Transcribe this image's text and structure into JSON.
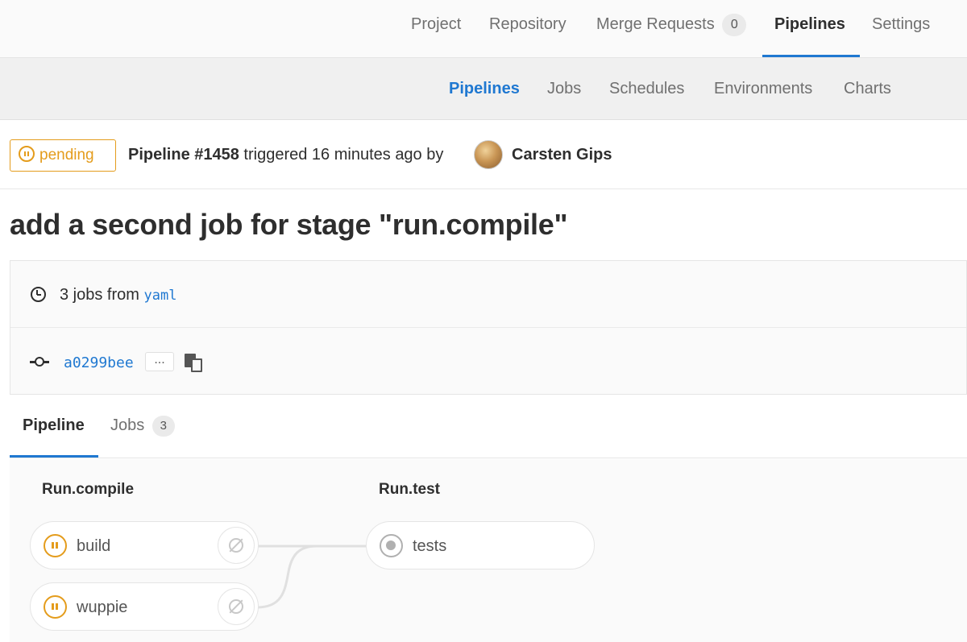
{
  "top_nav": {
    "items": [
      {
        "label": "Project"
      },
      {
        "label": "Repository"
      },
      {
        "label": "Merge Requests",
        "count": "0"
      },
      {
        "label": "Pipelines"
      },
      {
        "label": "Settings"
      }
    ],
    "active": "Pipelines"
  },
  "sub_nav": {
    "items": [
      {
        "label": "Pipelines"
      },
      {
        "label": "Jobs"
      },
      {
        "label": "Schedules"
      },
      {
        "label": "Environments"
      },
      {
        "label": "Charts"
      }
    ],
    "active": "Pipelines"
  },
  "pipeline_header": {
    "status": "pending",
    "pipeline_id": "Pipeline #1458",
    "triggered_text": " triggered 16 minutes ago by",
    "author": "Carsten Gips"
  },
  "commit_title": "add a second job for stage \"run.compile\"",
  "info": {
    "jobs_text": "3 jobs from ",
    "jobs_source": "yaml",
    "commit_sha": "a0299bee",
    "ellipsis": "..."
  },
  "tabs": [
    {
      "label": "Pipeline"
    },
    {
      "label": "Jobs",
      "count": "3"
    }
  ],
  "graph": {
    "stages": [
      {
        "title": "Run.compile",
        "jobs": [
          {
            "name": "build",
            "status": "pending"
          },
          {
            "name": "wuppie",
            "status": "pending"
          }
        ]
      },
      {
        "title": "Run.test",
        "jobs": [
          {
            "name": "tests",
            "status": "created"
          }
        ]
      }
    ]
  },
  "colors": {
    "accent": "#1f78d1",
    "pending": "#e49c1c",
    "created": "#b0b0b0"
  },
  "icons": {
    "status": "pause-circle-icon",
    "clock": "clock-icon",
    "commit": "commit-icon",
    "copy": "clipboard-icon",
    "cancel": "cancel-icon"
  }
}
